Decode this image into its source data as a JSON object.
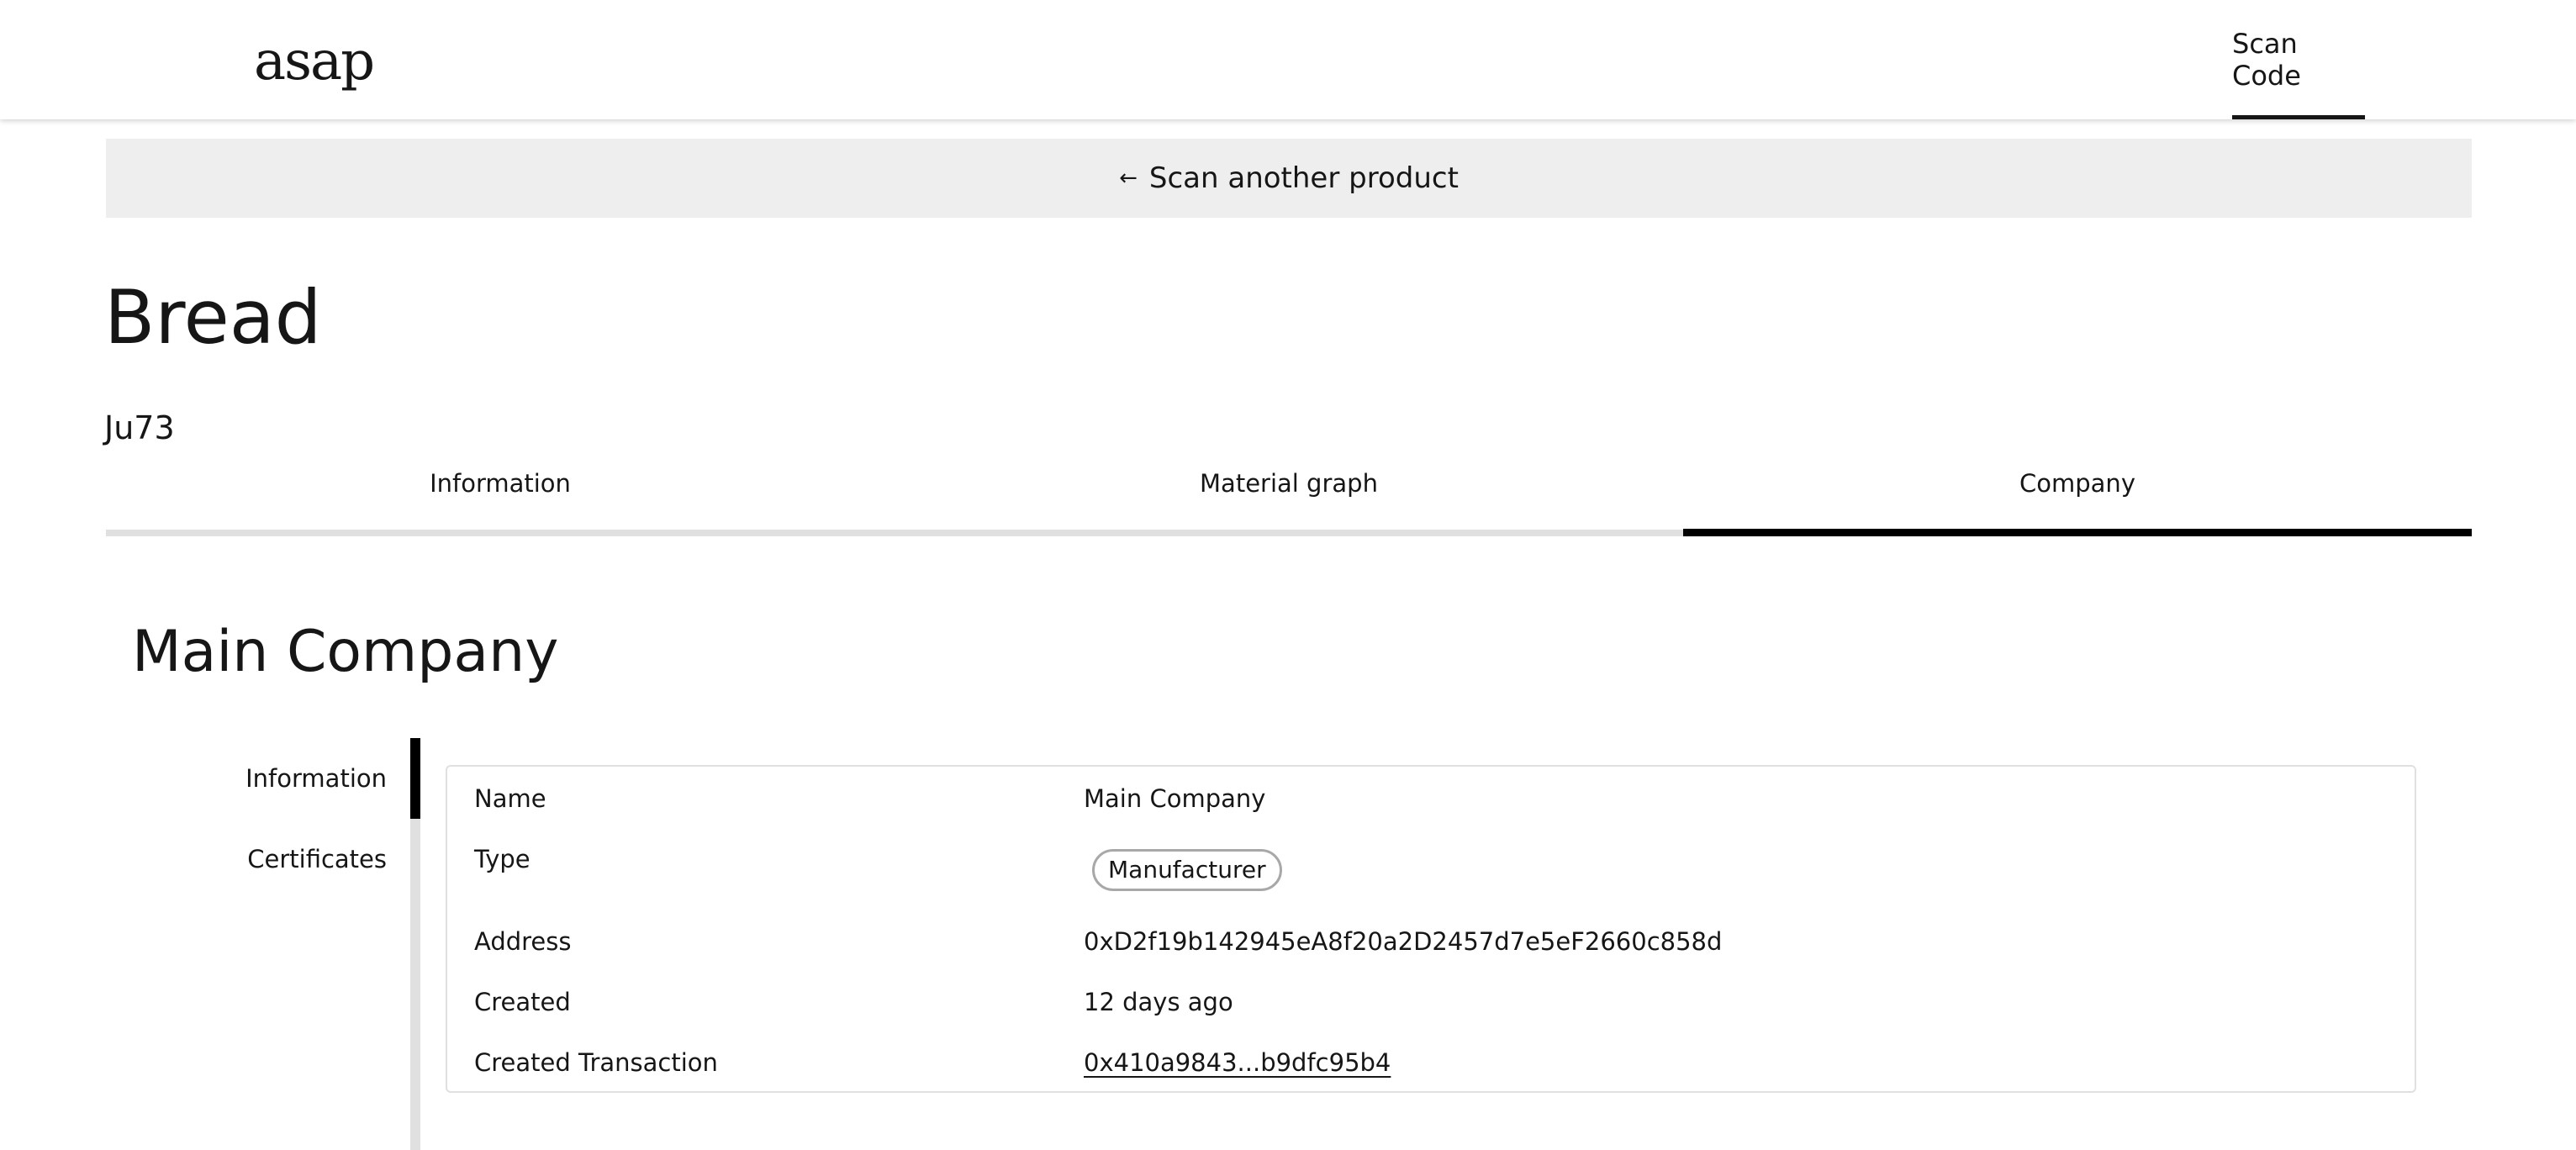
{
  "header": {
    "logo_text": "asap",
    "nav_scan_code": "Scan Code"
  },
  "back_banner": {
    "arrow": "←",
    "label": "Scan another product"
  },
  "product": {
    "title": "Bread",
    "code": "Ju73"
  },
  "tabs": [
    {
      "label": "Information",
      "active": false
    },
    {
      "label": "Material graph",
      "active": false
    },
    {
      "label": "Company",
      "active": true
    }
  ],
  "company": {
    "title": "Main Company",
    "side_nav": [
      {
        "label": "Information",
        "active": true
      },
      {
        "label": "Certificates",
        "active": false
      }
    ],
    "details": {
      "name_label": "Name",
      "name_value": "Main Company",
      "type_label": "Type",
      "type_value": "Manufacturer",
      "address_label": "Address",
      "address_value": "0xD2f19b142945eA8f20a2D2457d7e5eF2660c858d",
      "created_label": "Created",
      "created_value": "12 days ago",
      "created_tx_label": "Created Transaction",
      "created_tx_value": "0x410a9843...b9dfc95b4"
    }
  }
}
